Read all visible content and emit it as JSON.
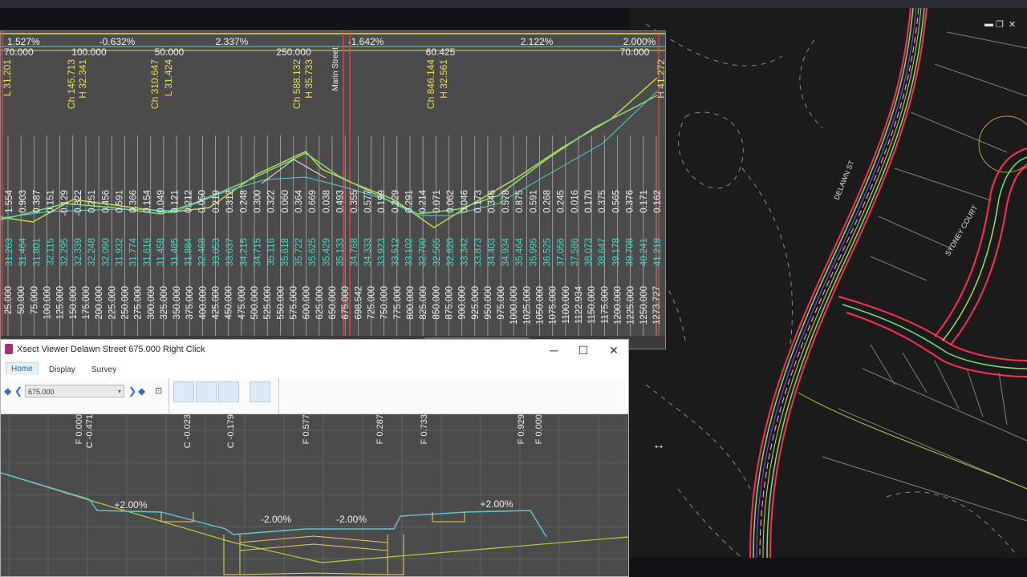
{
  "profile": {
    "grades": [
      "1.527%",
      "-0.632%",
      "2.337%",
      "-1.642%",
      "2.122%",
      "2.000%"
    ],
    "vc_lengths": [
      "70.000",
      "100.000",
      "50.000",
      "250.000",
      "60.425",
      "70.000"
    ],
    "ip_labels": [
      "L 31.201",
      "Ch 145.713",
      "H 32.341",
      "Ch 310.647",
      "L 31.424",
      "Ch 588.132",
      "H 35.733",
      "Ch 846.144",
      "H 32.561",
      "H 41.272"
    ],
    "road_label": "Marin Street",
    "cut_fill": [
      "1.554",
      "0.903",
      "0.387",
      "0.151",
      "-0.129",
      "-0.322",
      "0.251",
      "0.456",
      "0.591",
      "0.366",
      "0.154",
      "0.049",
      "0.121",
      "0.212",
      "0.050",
      "0.219",
      "0.312",
      "0.248",
      "0.300",
      "0.322",
      "0.060",
      "0.364",
      "0.669",
      "0.038",
      "0.493",
      "0.355",
      "0.577",
      "0.199",
      "0.229",
      "0.291",
      "0.214",
      "0.071",
      "0.062",
      "0.046",
      "0.173",
      "0.346",
      "0.578",
      "0.875",
      "0.591",
      "0.268",
      "0.245",
      "0.016",
      "0.170",
      "0.375",
      "0.565",
      "0.376",
      "0.171",
      "0.162"
    ],
    "design_levels": [
      "31.263",
      "31.464",
      "31.801",
      "32.115",
      "32.295",
      "32.339",
      "32.248",
      "32.090",
      "31.932",
      "31.774",
      "31.616",
      "31.458",
      "31.485",
      "31.884",
      "32.468",
      "33.053",
      "33.637",
      "34.215",
      "34.715",
      "35.116",
      "35.618",
      "35.722",
      "35.625",
      "35.429",
      "35.133",
      "34.768",
      "34.333",
      "33.923",
      "33.512",
      "33.102",
      "32.700",
      "32.565",
      "32.820",
      "33.342",
      "33.873",
      "34.403",
      "34.934",
      "35.464",
      "35.995",
      "36.525",
      "37.056",
      "37.586",
      "38.073",
      "38.647",
      "39.178",
      "39.708",
      "40.241",
      "41.218"
    ],
    "chainages": [
      "25.000",
      "50.000",
      "75.000",
      "100.000",
      "125.000",
      "150.000",
      "175.000",
      "200.000",
      "225.000",
      "250.000",
      "275.000",
      "300.000",
      "325.000",
      "350.000",
      "375.000",
      "400.000",
      "425.000",
      "450.000",
      "475.000",
      "500.000",
      "525.000",
      "550.000",
      "575.000",
      "600.000",
      "625.000",
      "650.000",
      "675.000",
      "698.542",
      "725.000",
      "750.000",
      "775.000",
      "800.000",
      "825.000",
      "850.000",
      "875.000",
      "900.000",
      "925.000",
      "950.000",
      "975.000",
      "1000.000",
      "1025.000",
      "1050.000",
      "1075.000",
      "1100.000",
      "1122.934",
      "1150.000",
      "1175.000",
      "1200.000",
      "1225.000",
      "1250.000",
      "1273.727"
    ]
  },
  "xsect": {
    "title": "Xsect Viewer Delawn Street  675.000  Right Click",
    "tabs": [
      "Home",
      "Display",
      "Survey"
    ],
    "station_value": "675.000",
    "controls": {
      "minimize": "─",
      "maximize": "☐",
      "close": "✕"
    },
    "labels_top": [
      "F 0.000",
      "C -0.471",
      "C -0.023",
      "C -0.179",
      "F 0.577",
      "F 0.287",
      "F 0.733",
      "F 0.929",
      "F 0.000"
    ],
    "grades": [
      "+2.00%",
      "-2.00%",
      "-2.00%",
      "+2.00%"
    ]
  },
  "plan": {
    "street_labels": [
      "DELAWN ST",
      "SYDNEY COURT"
    ],
    "window_controls": {
      "minimize": "▬",
      "restore": "❐",
      "close": "✕"
    }
  },
  "colors": {
    "design": "#7fe07f",
    "existing": "#c8d84a",
    "levels": "#4fd8c8",
    "chainage": "#f0f0f0",
    "grade_text": "#f5f5f5",
    "ip_text": "#e8e060"
  }
}
